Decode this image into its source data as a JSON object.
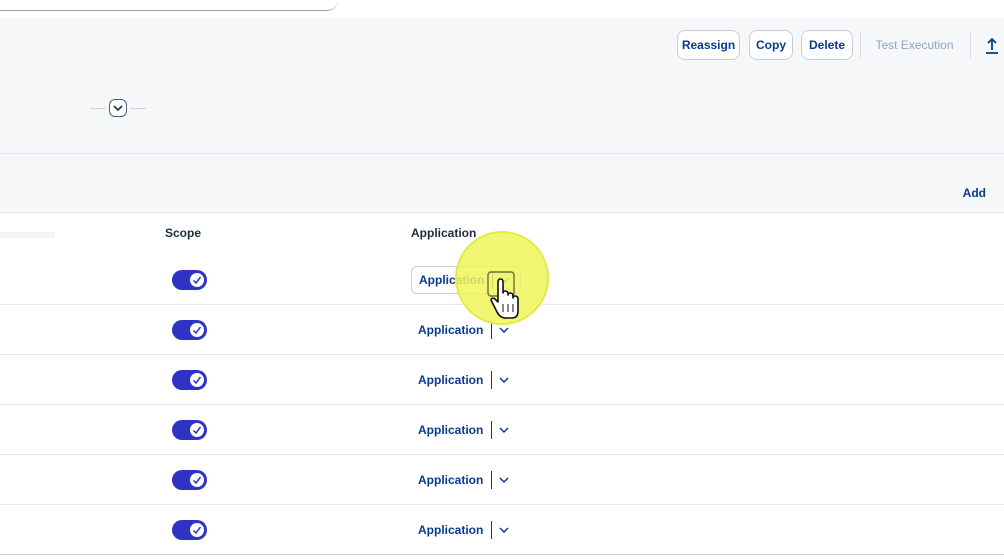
{
  "toolbar": {
    "reassign_label": "Reassign",
    "copy_label": "Copy",
    "delete_label": "Delete",
    "test_execution_label": "Test Execution",
    "upload_icon": "upload-icon"
  },
  "section": {
    "add_label": "Add"
  },
  "table": {
    "columns": [
      "Scope",
      "Application"
    ],
    "rows": [
      {
        "scope_enabled": true,
        "application": "Application"
      },
      {
        "scope_enabled": true,
        "application": "Application"
      },
      {
        "scope_enabled": true,
        "application": "Application"
      },
      {
        "scope_enabled": true,
        "application": "Application"
      },
      {
        "scope_enabled": true,
        "application": "Application"
      },
      {
        "scope_enabled": true,
        "application": "Application"
      }
    ]
  },
  "colors": {
    "accent": "#2f33c4",
    "link": "#0a3a8e",
    "disabled": "#8fa5c9",
    "cursor_highlight": "#eef55a"
  }
}
